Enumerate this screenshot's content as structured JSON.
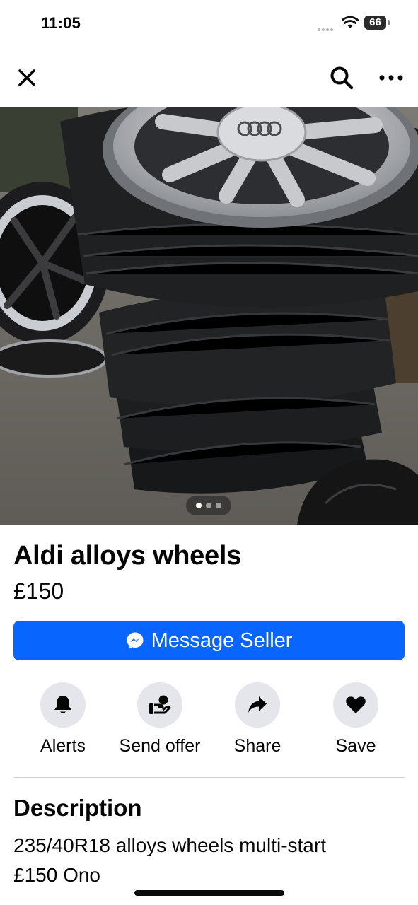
{
  "status_bar": {
    "time": "11:05",
    "battery": "66"
  },
  "nav": {
    "close_icon": "close-icon",
    "search_icon": "search-icon",
    "more_icon": "more-icon"
  },
  "listing": {
    "title": "Aldi alloys wheels",
    "price": "£150",
    "photo_count": 3,
    "current_photo": 1
  },
  "message_button": {
    "label": "Message Seller",
    "icon": "messenger-icon",
    "color": "#0866ff"
  },
  "actions": [
    {
      "label": "Alerts",
      "icon": "bell-icon"
    },
    {
      "label": "Send offer",
      "icon": "offer-icon"
    },
    {
      "label": "Share",
      "icon": "share-icon"
    },
    {
      "label": "Save",
      "icon": "heart-icon"
    }
  ],
  "description": {
    "heading": "Description",
    "line1": "235/40R18 alloys wheels multi-start",
    "line2": "£150 Ono"
  }
}
